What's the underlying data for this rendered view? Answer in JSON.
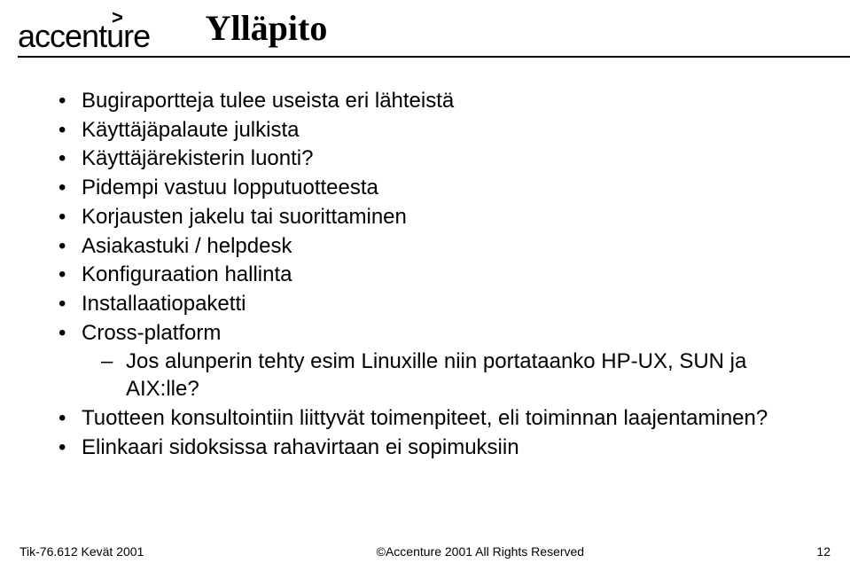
{
  "logo": {
    "caret": ">",
    "text": "accenture"
  },
  "title": "Ylläpito",
  "bullets": [
    {
      "text": "Bugiraportteja tulee useista eri lähteistä"
    },
    {
      "text": "Käyttäjäpalaute julkista"
    },
    {
      "text": "Käyttäjärekisterin luonti?"
    },
    {
      "text": "Pidempi vastuu lopputuotteesta"
    },
    {
      "text": "Korjausten jakelu tai suorittaminen"
    },
    {
      "text": "Asiakastuki / helpdesk"
    },
    {
      "text": "Konfiguraation hallinta"
    },
    {
      "text": "Installaatiopaketti"
    },
    {
      "text": "Cross-platform",
      "sub": [
        {
          "text": "Jos alunperin tehty esim Linuxille niin portataanko HP-UX, SUN ja AIX:lle?"
        }
      ]
    },
    {
      "text": "Tuotteen konsultointiin liittyvät toimenpiteet, eli toiminnan laajentaminen?"
    },
    {
      "text": "Elinkaari sidoksissa rahavirtaan ei sopimuksiin"
    }
  ],
  "footer": {
    "left": "Tik-76.612 Kevät 2001",
    "center": "©Accenture 2001 All Rights Reserved",
    "right": "12"
  }
}
